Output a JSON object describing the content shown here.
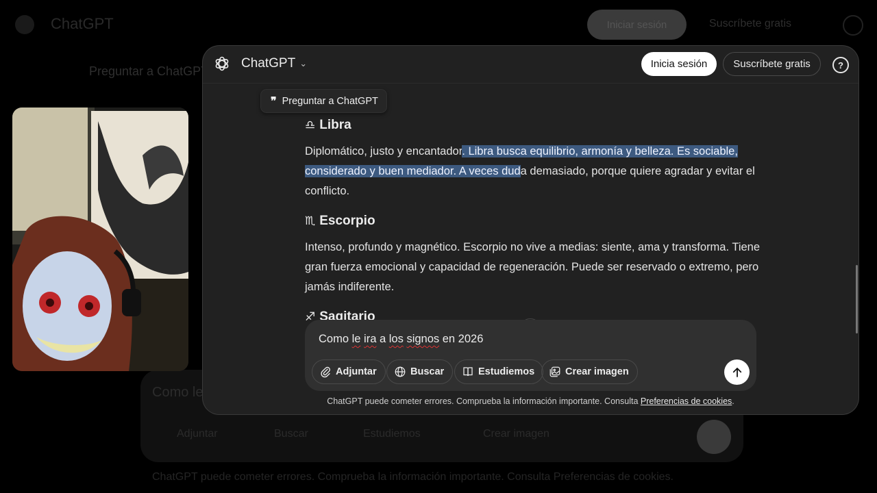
{
  "background": {
    "title": "ChatGPT",
    "login_label": "Iniciar sesión",
    "signup_label": "Suscríbete gratis",
    "quote_label": "Preguntar a ChatGPT",
    "composer_text": "Como le ira",
    "tools": [
      "Adjuntar",
      "Buscar",
      "Estudiemos",
      "Crear imagen"
    ],
    "footer_text": "ChatGPT puede cometer errores. Comprueba la información importante. Consulta Preferencias de cookies."
  },
  "header": {
    "title": "ChatGPT",
    "login_label": "Inicia sesión",
    "signup_label": "Suscríbete gratis",
    "help_icon": "?"
  },
  "ask_button": {
    "icon": "❞",
    "label": "Preguntar a ChatGPT"
  },
  "signs": [
    {
      "glyph": "♎︎",
      "name": "Libra",
      "text_before": "Diplomático, justo y encantador",
      "text_highlight": ". Libra busca equilibrio, armonía y belleza. Es sociable, considerado y buen mediador. A veces dud",
      "text_after": "a demasiado, porque quiere agradar y evitar el conflicto."
    },
    {
      "glyph": "♏︎",
      "name": "Escorpio",
      "text": "Intenso, profundo y magnético. Escorpio no vive a medias: siente, ama y transforma. Tiene gran fuerza emocional y capacidad de regeneración. Puede ser reservado o extremo, pero jamás indiferente."
    },
    {
      "glyph": "♐︎",
      "name": "Sagitario"
    }
  ],
  "composer": {
    "p1": "Como ",
    "p2": "le",
    "p3": " ",
    "p4": "ira",
    "p5": " a ",
    "p6": "los",
    "p7": " ",
    "p8": "signos",
    "p9": " en 2026",
    "tools": {
      "attach": "Adjuntar",
      "search": "Buscar",
      "study": "Estudiemos",
      "image": "Crear imagen"
    }
  },
  "footer": {
    "text": "ChatGPT puede cometer errores. Comprueba la información importante. Consulta ",
    "link": "Preferencias de cookies",
    "end": "."
  },
  "colors": {
    "selection": "#3d5a80",
    "window_bg": "#212121",
    "composer_bg": "#303030"
  }
}
